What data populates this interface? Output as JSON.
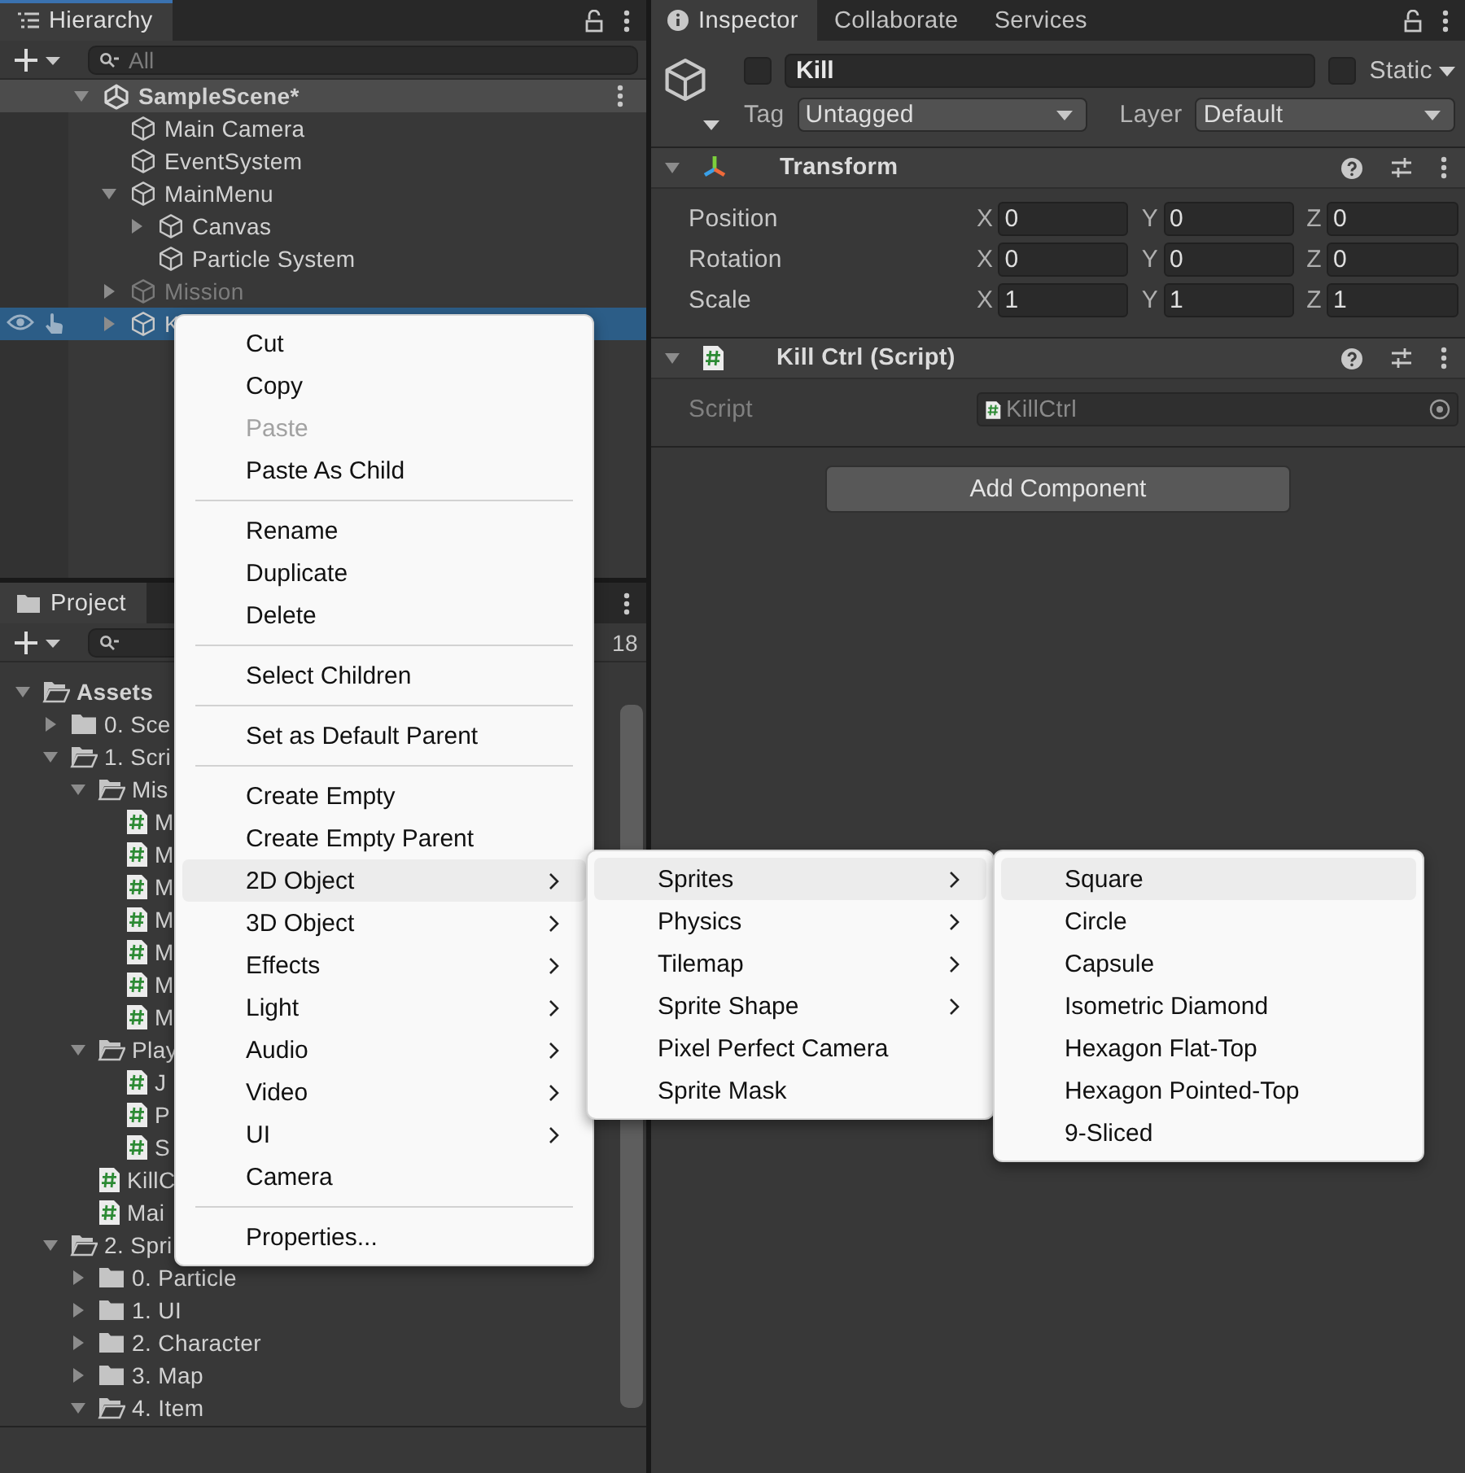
{
  "hierarchy": {
    "title": "Hierarchy",
    "search": {
      "placeholder": "All"
    },
    "scene": {
      "name": "SampleScene*",
      "expanded": true
    },
    "items": [
      {
        "label": "Main Camera",
        "selected": false,
        "disabled": false
      },
      {
        "label": "EventSystem",
        "selected": false,
        "disabled": false
      },
      {
        "label": "MainMenu",
        "expanded": true,
        "selected": false,
        "disabled": false,
        "children": [
          {
            "label": "Canvas",
            "expanded": false,
            "selected": false,
            "disabled": false
          },
          {
            "label": "Particle System",
            "selected": false,
            "disabled": false
          }
        ]
      },
      {
        "label": "Mission",
        "expanded": false,
        "selected": false,
        "disabled": true
      },
      {
        "label": "K",
        "expanded": false,
        "selected": true,
        "disabled": false
      }
    ]
  },
  "project": {
    "title": "Project",
    "count": "18",
    "items": [
      {
        "label": "Assets",
        "kind": "folder",
        "expanded": true,
        "children": [
          {
            "label": "0. Sce",
            "kind": "folder",
            "expanded": false
          },
          {
            "label": "1. Scri",
            "kind": "folder",
            "expanded": true,
            "children": [
              {
                "label": "Mis",
                "kind": "folder",
                "expanded": true,
                "children": [
                  {
                    "label": "M",
                    "kind": "script"
                  },
                  {
                    "label": "M",
                    "kind": "script"
                  },
                  {
                    "label": "M",
                    "kind": "script"
                  },
                  {
                    "label": "M",
                    "kind": "script"
                  },
                  {
                    "label": "M",
                    "kind": "script"
                  },
                  {
                    "label": "M",
                    "kind": "script"
                  },
                  {
                    "label": "M",
                    "kind": "script"
                  }
                ]
              },
              {
                "label": "Play",
                "kind": "folder",
                "expanded": true,
                "children": [
                  {
                    "label": "J",
                    "kind": "script"
                  },
                  {
                    "label": "P",
                    "kind": "script"
                  },
                  {
                    "label": "S",
                    "kind": "script"
                  }
                ]
              },
              {
                "label": "KillC",
                "kind": "script"
              },
              {
                "label": "Mai",
                "kind": "script"
              }
            ]
          },
          {
            "label": "2. Spri",
            "kind": "folder",
            "expanded": true,
            "children": [
              {
                "label": "0. Particle",
                "kind": "folder",
                "expanded": false
              },
              {
                "label": "1. UI",
                "kind": "folder",
                "expanded": false
              },
              {
                "label": "2. Character",
                "kind": "folder",
                "expanded": false
              },
              {
                "label": "3. Map",
                "kind": "folder",
                "expanded": false
              },
              {
                "label": "4. Item",
                "kind": "folder",
                "expanded": true
              }
            ]
          }
        ]
      }
    ]
  },
  "inspector": {
    "tabs": [
      {
        "label": "Inspector",
        "selected": true
      },
      {
        "label": "Collaborate",
        "selected": false
      },
      {
        "label": "Services",
        "selected": false
      }
    ],
    "object": {
      "active": false,
      "name": "Kill",
      "static": false,
      "static_label": "Static",
      "tag_label": "Tag",
      "tag": "Untagged",
      "layer_label": "Layer",
      "layer": "Default"
    },
    "components": [
      {
        "kind": "transform",
        "title": "Transform",
        "expanded": true,
        "rows": [
          {
            "label": "Position",
            "disabled": false,
            "fields": [
              {
                "axis": "X",
                "value": "0"
              },
              {
                "axis": "Y",
                "value": "0"
              },
              {
                "axis": "Z",
                "value": "0"
              }
            ]
          },
          {
            "label": "Rotation",
            "disabled": false,
            "fields": [
              {
                "axis": "X",
                "value": "0"
              },
              {
                "axis": "Y",
                "value": "0"
              },
              {
                "axis": "Z",
                "value": "0"
              }
            ]
          },
          {
            "label": "Scale",
            "disabled": false,
            "fields": [
              {
                "axis": "X",
                "value": "1"
              },
              {
                "axis": "Y",
                "value": "1"
              },
              {
                "axis": "Z",
                "value": "1"
              }
            ]
          }
        ]
      },
      {
        "kind": "script",
        "title": "Kill Ctrl (Script)",
        "expanded": true,
        "rows": [
          {
            "label": "Script",
            "disabled": true,
            "value": "KillCtrl"
          }
        ]
      }
    ],
    "add_button": "Add Component"
  },
  "context_menu": {
    "groups": [
      [
        {
          "label": "Cut",
          "disabled": false,
          "selected": false,
          "submenu": false
        },
        {
          "label": "Copy",
          "disabled": false,
          "selected": false,
          "submenu": false
        },
        {
          "label": "Paste",
          "disabled": true,
          "selected": false,
          "submenu": false
        },
        {
          "label": "Paste As Child",
          "disabled": false,
          "selected": false,
          "submenu": false
        }
      ],
      [
        {
          "label": "Rename",
          "disabled": false,
          "selected": false,
          "submenu": false
        },
        {
          "label": "Duplicate",
          "disabled": false,
          "selected": false,
          "submenu": false
        },
        {
          "label": "Delete",
          "disabled": false,
          "selected": false,
          "submenu": false
        }
      ],
      [
        {
          "label": "Select Children",
          "disabled": false,
          "selected": false,
          "submenu": false
        }
      ],
      [
        {
          "label": "Set as Default Parent",
          "disabled": false,
          "selected": false,
          "submenu": false
        }
      ],
      [
        {
          "label": "Create Empty",
          "disabled": false,
          "selected": false,
          "submenu": false
        },
        {
          "label": "Create Empty Parent",
          "disabled": false,
          "selected": false,
          "submenu": false
        },
        {
          "label": "2D Object",
          "disabled": false,
          "selected": true,
          "submenu": true
        },
        {
          "label": "3D Object",
          "disabled": false,
          "selected": false,
          "submenu": true
        },
        {
          "label": "Effects",
          "disabled": false,
          "selected": false,
          "submenu": true
        },
        {
          "label": "Light",
          "disabled": false,
          "selected": false,
          "submenu": true
        },
        {
          "label": "Audio",
          "disabled": false,
          "selected": false,
          "submenu": true
        },
        {
          "label": "Video",
          "disabled": false,
          "selected": false,
          "submenu": true
        },
        {
          "label": "UI",
          "disabled": false,
          "selected": false,
          "submenu": true
        },
        {
          "label": "Camera",
          "disabled": false,
          "selected": false,
          "submenu": false
        }
      ],
      [
        {
          "label": "Properties...",
          "disabled": false,
          "selected": false,
          "submenu": false
        }
      ]
    ]
  },
  "submenus": [
    {
      "items": [
        {
          "label": "Sprites",
          "disabled": false,
          "selected": true,
          "submenu": true
        },
        {
          "label": "Physics",
          "disabled": false,
          "selected": false,
          "submenu": true
        },
        {
          "label": "Tilemap",
          "disabled": false,
          "selected": false,
          "submenu": true
        },
        {
          "label": "Sprite Shape",
          "disabled": false,
          "selected": false,
          "submenu": true
        },
        {
          "label": "Pixel Perfect Camera",
          "disabled": false,
          "selected": false,
          "submenu": false
        },
        {
          "label": "Sprite Mask",
          "disabled": false,
          "selected": false,
          "submenu": false
        }
      ]
    },
    {
      "items": [
        {
          "label": "Square",
          "disabled": false,
          "selected": true,
          "submenu": false
        },
        {
          "label": "Circle",
          "disabled": false,
          "selected": false,
          "submenu": false
        },
        {
          "label": "Capsule",
          "disabled": false,
          "selected": false,
          "submenu": false
        },
        {
          "label": "Isometric Diamond",
          "disabled": false,
          "selected": false,
          "submenu": false
        },
        {
          "label": "Hexagon Flat-Top",
          "disabled": false,
          "selected": false,
          "submenu": false
        },
        {
          "label": "Hexagon Pointed-Top",
          "disabled": false,
          "selected": false,
          "submenu": false
        },
        {
          "label": "9-Sliced",
          "disabled": false,
          "selected": false,
          "submenu": false
        }
      ]
    }
  ]
}
